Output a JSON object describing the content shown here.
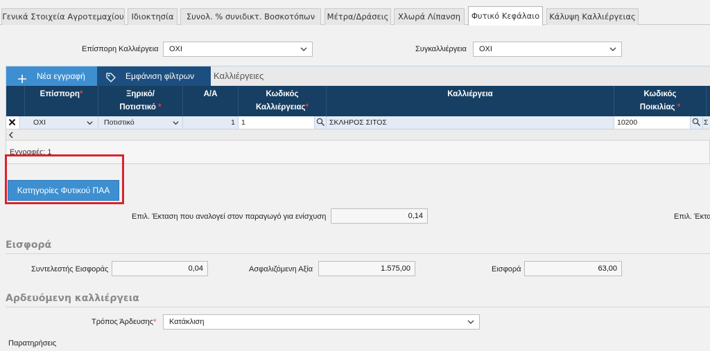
{
  "tabs": [
    {
      "label": "Γενικά Στοιχεία Αγροτεμαχίου"
    },
    {
      "label": "Ιδιοκτησία"
    },
    {
      "label": "Συνολ. % συνιδικτ. Βοσκοτόπων"
    },
    {
      "label": "Μέτρα/Δράσεις"
    },
    {
      "label": "Χλωρά Λίπανση"
    },
    {
      "label": "Φυτικό Κεφάλαιο"
    },
    {
      "label": "Κάλυψη Καλλιέργειας"
    }
  ],
  "filters": {
    "episporh_label": "Επίσπορη Καλλιέργεια",
    "episporh_value": "ΟΧΙ",
    "sygkalliergeia_label": "Συγκαλλιέργεια",
    "sygkalliergeia_value": "ΟΧΙ"
  },
  "toolbar": {
    "new_record": "Νέα εγγραφή",
    "show_filters": "Εμφάνιση φίλτρων",
    "grid_title": "Καλλιέργειες"
  },
  "grid": {
    "columns": [
      {
        "line1": "Επίσπορη",
        "line2": "",
        "required": true
      },
      {
        "line1": "Ξηρικό/",
        "line2": "Ποτιστικό",
        "required": true
      },
      {
        "line1": "Α/Α",
        "line2": "",
        "required": false
      },
      {
        "line1": "Κωδικός",
        "line2": "Καλλιέργειας",
        "required": true
      },
      {
        "line1": "Καλλιέργεια",
        "line2": "",
        "required": false
      },
      {
        "line1": "Κωδικός",
        "line2": "Ποικιλίας",
        "required": true
      }
    ],
    "row": {
      "episporh": "ΟΧΙ",
      "xhriko": "Ποτιστικό",
      "aa": "1",
      "kodikos_kalliergeias": "1",
      "kalliergeia": "ΣΚΛΗΡΟΣ ΣΙΤΟΣ",
      "kodikos_poikilias": "10200",
      "overflow": "Σ"
    },
    "records_label": "Εγγραφές: 1"
  },
  "categories_button": "Κατηγορίες Φυτικού ΠΑΑ",
  "epil": {
    "label": "Επιλ. Έκταση που αναλογεί στον παραγωγό για ενίσχυση",
    "value": "0,14",
    "label_right": "Επιλ. Έκτα"
  },
  "eisfora_section": {
    "title": "Εισφορά",
    "syntelestis_label": "Συντελεστής Εισφοράς",
    "syntelestis_value": "0,04",
    "asfalizomeni_label": "Ασφαλιζόμενη Αξία",
    "asfalizomeni_value": "1.575,00",
    "eisfora_label": "Εισφορά",
    "eisfora_value": "63,00"
  },
  "ardeusi_section": {
    "title": "Αρδευόμενη καλλιέργεια",
    "tropos_label": "Τρόπος Άρδευσης",
    "tropos_value": "Κατάκλιση"
  },
  "paratiriseis_label": "Παρατηρήσεις",
  "colors": {
    "header_bg": "#173f63",
    "button_blue": "#3e8fd2",
    "highlight_red": "#d9232d",
    "required": "#e3413f"
  }
}
